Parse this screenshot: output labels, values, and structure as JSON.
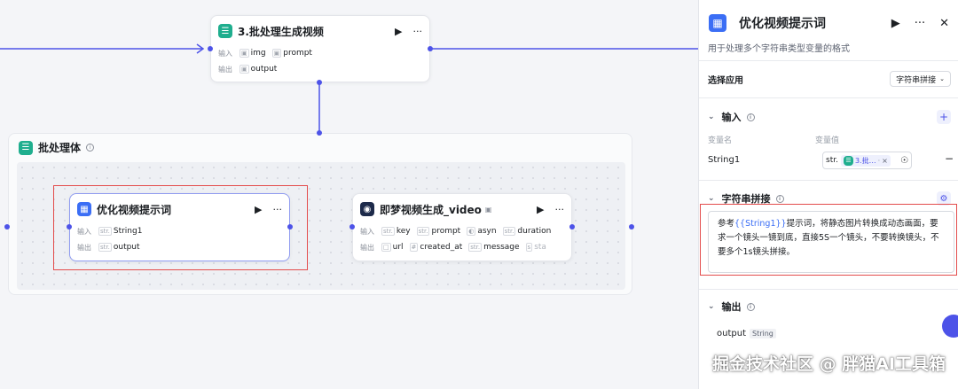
{
  "canvas": {
    "top_node": {
      "title": "3.批处理生成视频",
      "input_label": "输入",
      "inputs": [
        "img",
        "prompt"
      ],
      "output_label": "输出",
      "outputs": [
        "output"
      ]
    },
    "batch_group": {
      "title": "批处理体",
      "node_optimize": {
        "title": "优化视频提示词",
        "input_label": "输入",
        "inputs": [
          {
            "type": "str.",
            "name": "String1"
          }
        ],
        "output_label": "输出",
        "outputs": [
          {
            "type": "str.",
            "name": "output"
          }
        ]
      },
      "node_video": {
        "title": "即梦视频生成_video",
        "input_label": "输入",
        "inputs": [
          {
            "type": "str.",
            "name": "key"
          },
          {
            "type": "str.",
            "name": "prompt"
          },
          {
            "type": "",
            "name": "asyn"
          },
          {
            "type": "str.",
            "name": "duration"
          }
        ],
        "output_label": "输出",
        "outputs": [
          {
            "type": "",
            "name": "url"
          },
          {
            "type": "",
            "name": "created_at"
          },
          {
            "type": "str.",
            "name": "message"
          },
          {
            "type": "",
            "name": "sta"
          }
        ],
        "more": "···"
      }
    }
  },
  "panel": {
    "title": "优化视频提示词",
    "description": "用于处理多个字符串类型变量的格式",
    "select_app_label": "选择应用",
    "select_app_value": "字符串拼接",
    "input_section": {
      "title": "输入",
      "col_name": "变量名",
      "col_value": "变量值",
      "var_name": "String1",
      "var_type": "str.",
      "var_ref": "3.批…",
      "var_ref_more": "·"
    },
    "concat_section": {
      "title": "字符串拼接",
      "template_prefix": "参考",
      "template_var": "{{String1}}",
      "template_rest": "提示词，将静态图片转换成动态画面，要求一个镜头一镜到底，直接5S一个镜头，不要转换镜头，不要多个1s镜头拼接。"
    },
    "output_section": {
      "title": "输出",
      "var_name": "output",
      "var_type": "String"
    }
  },
  "watermark": "掘金技术社区 @ 胖猫AI工具箱",
  "colors": {
    "accent": "#4d53e8",
    "highlight_red": "#e34c4c",
    "node_teal": "#1fae8e"
  }
}
